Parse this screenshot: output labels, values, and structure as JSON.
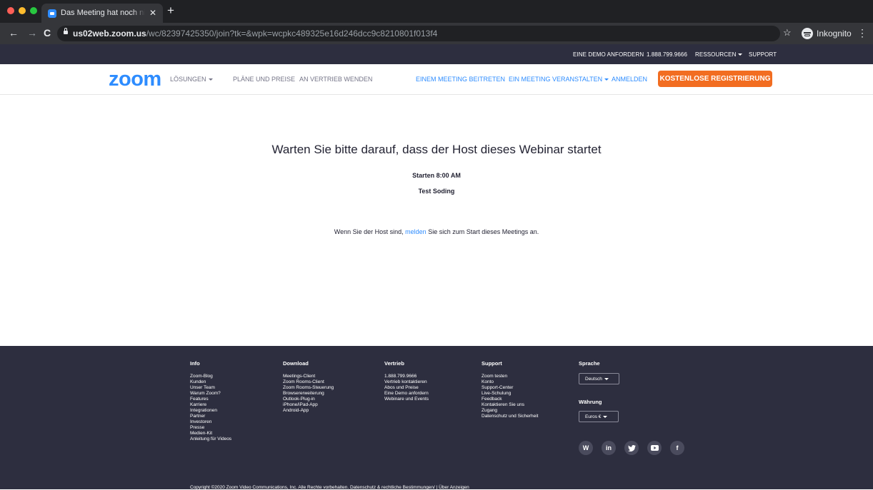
{
  "browser": {
    "tab_title": "Das Meeting hat noch nicht be",
    "tab_close": "✕",
    "new_tab": "+",
    "back": "←",
    "forward": "→",
    "reload": "C",
    "url_host": "us02web.zoom.us",
    "url_path": "/wc/82397425350/join?tk=&wpk=wcpkc489325e16d246dcc9c8210801f013f4",
    "bookmark_icon": "☆",
    "incognito_label": "Inkognito",
    "menu_icon": "⋮",
    "traffic_colors": [
      "#ff5f57",
      "#febc2e",
      "#28c840"
    ]
  },
  "topbar": {
    "demo": "EINE DEMO ANFORDERN",
    "phone": "1.888.799.9666",
    "resources": "RESSOURCEN",
    "support": "SUPPORT"
  },
  "nav": {
    "logo": "zoom",
    "solutions": "LÖSUNGEN",
    "plans": "PLÄNE UND PREISE",
    "sales": "AN VERTRIEB WENDEN",
    "join": "EINEM MEETING BEITRETEN",
    "host": "EIN MEETING VERANSTALTEN",
    "signin": "ANMELDEN",
    "signup": "KOSTENLOSE REGISTRIERUNG"
  },
  "content": {
    "heading": "Warten Sie bitte darauf, dass der Host dieses Webinar startet",
    "start_time": "Starten 8:00 AM",
    "host_name": "Test Soding",
    "notice_before": "Wenn Sie der Host sind,",
    "notice_link": "melden",
    "notice_after": "Sie sich zum Start dieses Meetings an."
  },
  "footer": {
    "info": {
      "title": "Info",
      "items": [
        "Zoom-Blog",
        "Kunden",
        "Unser Team",
        "Warum Zoom?",
        "Features",
        "Karriere",
        "Integrationen",
        "Partner",
        "Investoren",
        "Presse",
        "Medien-Kit",
        "Anleitung für Videos"
      ]
    },
    "download": {
      "title": "Download",
      "items": [
        "Meetings-Client",
        "Zoom Rooms-Client",
        "Zoom Rooms-Steuerung",
        "Browsererweiterung",
        "Outlook-Plug-in",
        "iPhone/iPad-App",
        "Android-App"
      ]
    },
    "sales": {
      "title": "Vertrieb",
      "items": [
        "1.888.799.9666",
        "Vertrieb kontaktieren",
        "Abos und Preise",
        "Eine Demo anfordern",
        "Webinare und Events"
      ]
    },
    "support": {
      "title": "Support",
      "items": [
        "Zoom testen",
        "Konto",
        "Support-Center",
        "Live-Schulung",
        "Feedback",
        "Kontaktieren Sie uns",
        "Zugang",
        "Datenschutz und Sicherheit"
      ]
    },
    "language_label": "Sprache",
    "language_value": "Deutsch",
    "currency_label": "Währung",
    "currency_value": "Euros €",
    "social": [
      "wordpress-icon",
      "linkedin-icon",
      "twitter-icon",
      "youtube-icon",
      "facebook-icon"
    ],
    "copyright": "Copyright ©2020 Zoom Video Communications, Inc. Alle Rechte vorbehalten.   Datenschutz & rechtliche Bestimmungen/   |  Über Anzeigen"
  }
}
